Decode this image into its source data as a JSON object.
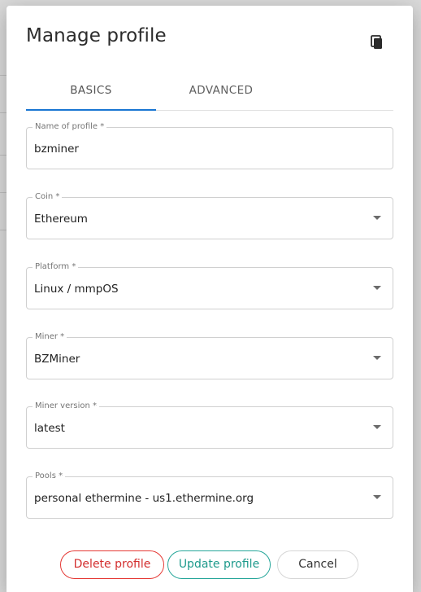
{
  "dialog": {
    "title": "Manage profile",
    "copy_icon": "copy-icon"
  },
  "tabs": [
    {
      "label": "BASICS",
      "active": true
    },
    {
      "label": "ADVANCED",
      "active": false
    }
  ],
  "fields": {
    "name": {
      "label": "Name of profile *",
      "value": "bzminer"
    },
    "coin": {
      "label": "Coin *",
      "value": "Ethereum"
    },
    "platform": {
      "label": "Platform *",
      "value": "Linux / mmpOS"
    },
    "miner": {
      "label": "Miner *",
      "value": "BZMiner"
    },
    "miner_version": {
      "label": "Miner version *",
      "value": "latest"
    },
    "pools": {
      "label": "Pools *",
      "value": "personal ethermine - us1.ethermine.org"
    }
  },
  "actions": {
    "delete_label": "Delete profile",
    "update_label": "Update profile",
    "cancel_label": "Cancel"
  },
  "colors": {
    "tab_indicator": "#1976d2",
    "delete": "#d32f2f",
    "update": "#1e9a8c"
  }
}
